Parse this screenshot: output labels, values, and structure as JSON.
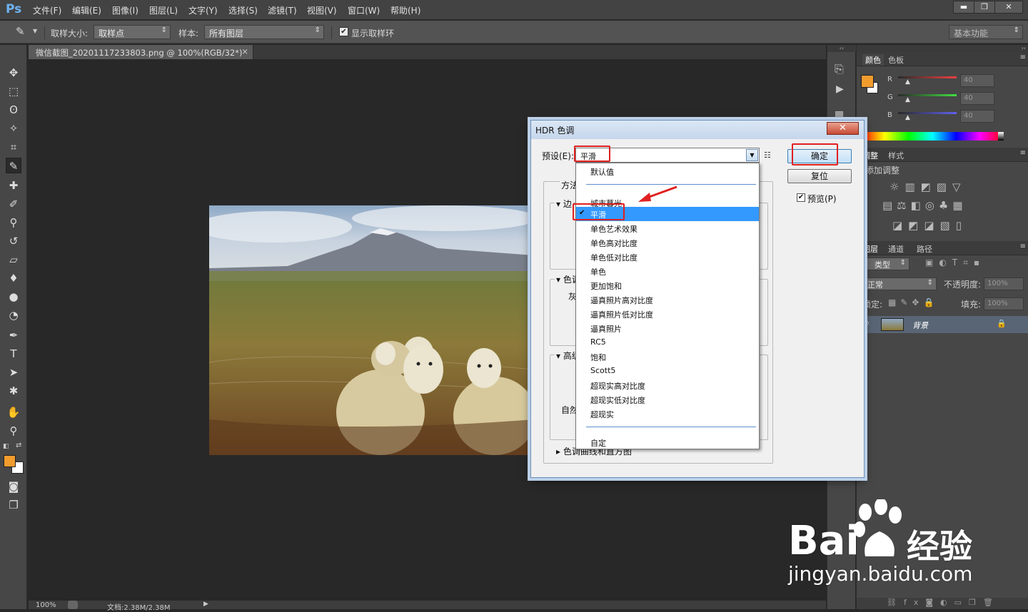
{
  "app": {
    "logo": "Ps"
  },
  "menu": [
    "文件(F)",
    "编辑(E)",
    "图像(I)",
    "图层(L)",
    "文字(Y)",
    "选择(S)",
    "滤镜(T)",
    "视图(V)",
    "窗口(W)",
    "帮助(H)"
  ],
  "window_controls": {
    "minimize": "▬",
    "restore": "❐",
    "close": "✕"
  },
  "options": {
    "sample_size_label": "取样大小:",
    "sample_size_value": "取样点",
    "sample_label": "样本:",
    "sample_value": "所有图层",
    "show_ring_label": "显示取样环",
    "workspace": "基本功能"
  },
  "document": {
    "tab_title": "微信截图_20201117233803.png @ 100%(RGB/32*) *",
    "close": "×"
  },
  "status": {
    "zoom": "100%",
    "doc_info": "文档:2.38M/2.38M"
  },
  "color_panel": {
    "tabs": [
      "颜色",
      "色板"
    ],
    "r_label": "R",
    "g_label": "G",
    "b_label": "B",
    "r_value": "40",
    "g_value": "40",
    "b_value": "40",
    "foreground": "#f39c2e"
  },
  "adjust_panel": {
    "tabs": [
      "调整",
      "样式"
    ],
    "title": "添加调整"
  },
  "layers_panel": {
    "tabs": [
      "图层",
      "通道",
      "路径"
    ],
    "kind": "类型",
    "blend": "正常",
    "opacity_label": "不透明度:",
    "opacity_value": "100%",
    "lock_label": "锁定:",
    "fill_label": "填充:",
    "fill_value": "100%",
    "layer_name": "背景"
  },
  "dialog": {
    "title": "HDR 色调",
    "close": "✕",
    "preset_label": "预设(E):",
    "preset_value": "平滑",
    "ok_label": "确定",
    "reset_label": "复位",
    "preview_label": "预览(P)",
    "method_label": "方法",
    "edge_label": "边",
    "tone_label": "色调",
    "gamma_label": "灰",
    "advanced_label": "高级",
    "natural_label": "自然",
    "curve_label": "色调曲线和直方图"
  },
  "dropdown": {
    "items": [
      "默认值",
      "城市暮光",
      "平滑",
      "单色艺术效果",
      "单色高对比度",
      "单色低对比度",
      "单色",
      "更加饱和",
      "逼真照片高对比度",
      "逼真照片低对比度",
      "逼真照片",
      "RC5",
      "饱和",
      "Scott5",
      "超现实高对比度",
      "超现实低对比度",
      "超现实",
      "自定"
    ],
    "selected": "平滑",
    "check": "✔"
  },
  "watermark": {
    "brand_en": "Bai",
    "brand_cn": "经验",
    "url": "jingyan.baidu.com"
  }
}
